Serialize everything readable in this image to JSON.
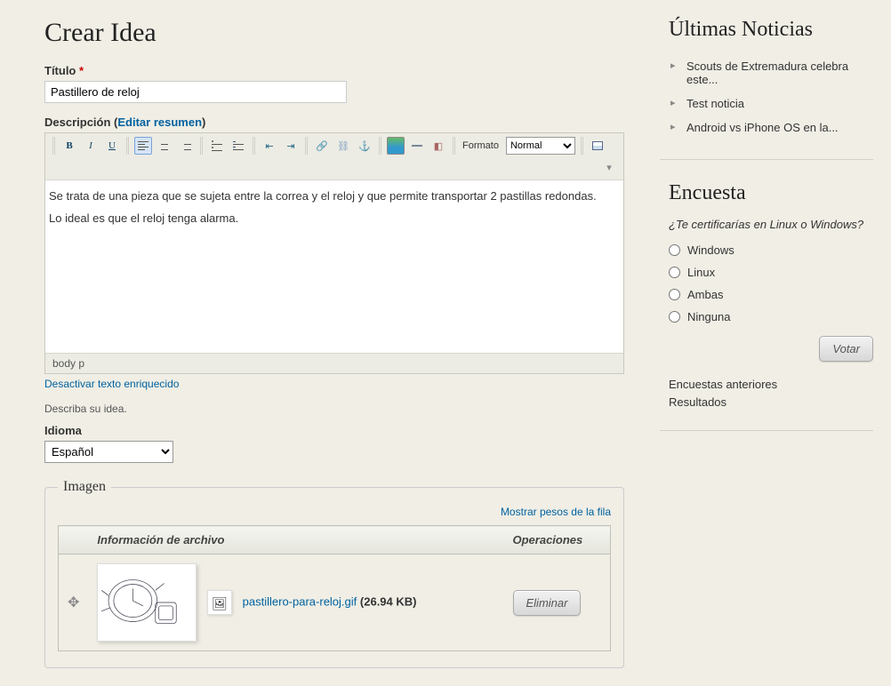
{
  "header": {
    "title": "Crear Idea"
  },
  "form": {
    "title_label": "Título",
    "title_value": "Pastillero de reloj",
    "desc_label": "Descripción",
    "desc_edit_summary": "Editar resumen",
    "format_label": "Formato",
    "format_value": "Normal",
    "content_line1": "Se trata de una pieza que se sujeta entre la correa y el reloj y que permite transportar 2 pastillas redondas.",
    "content_line2": "Lo ideal es que el reloj tenga alarma.",
    "status_path": "body   p",
    "disable_rich": "Desactivar texto enriquecido",
    "describe_help": "Describa su idea.",
    "lang_label": "Idioma",
    "lang_value": "Español"
  },
  "image_section": {
    "legend": "Imagen",
    "show_weights": "Mostrar pesos de la fila",
    "col_info": "Información de archivo",
    "col_ops": "Operaciones",
    "filename": "pastillero-para-reloj.gif",
    "filesize": "(26.94 KB)",
    "remove": "Eliminar"
  },
  "sidebar": {
    "news_title": "Últimas Noticias",
    "news": [
      "Scouts de Extremadura celebra este...",
      "Test noticia",
      "Android vs iPhone OS en la..."
    ],
    "poll_title": "Encuesta",
    "poll_q": "¿Te certificarías en Linux o Windows?",
    "poll_opts": [
      "Windows",
      "Linux",
      "Ambas",
      "Ninguna"
    ],
    "vote": "Votar",
    "prev_polls": "Encuestas anteriores",
    "results": "Resultados"
  },
  "icons": {
    "bold": "B",
    "italic": "I",
    "underline": "U"
  }
}
